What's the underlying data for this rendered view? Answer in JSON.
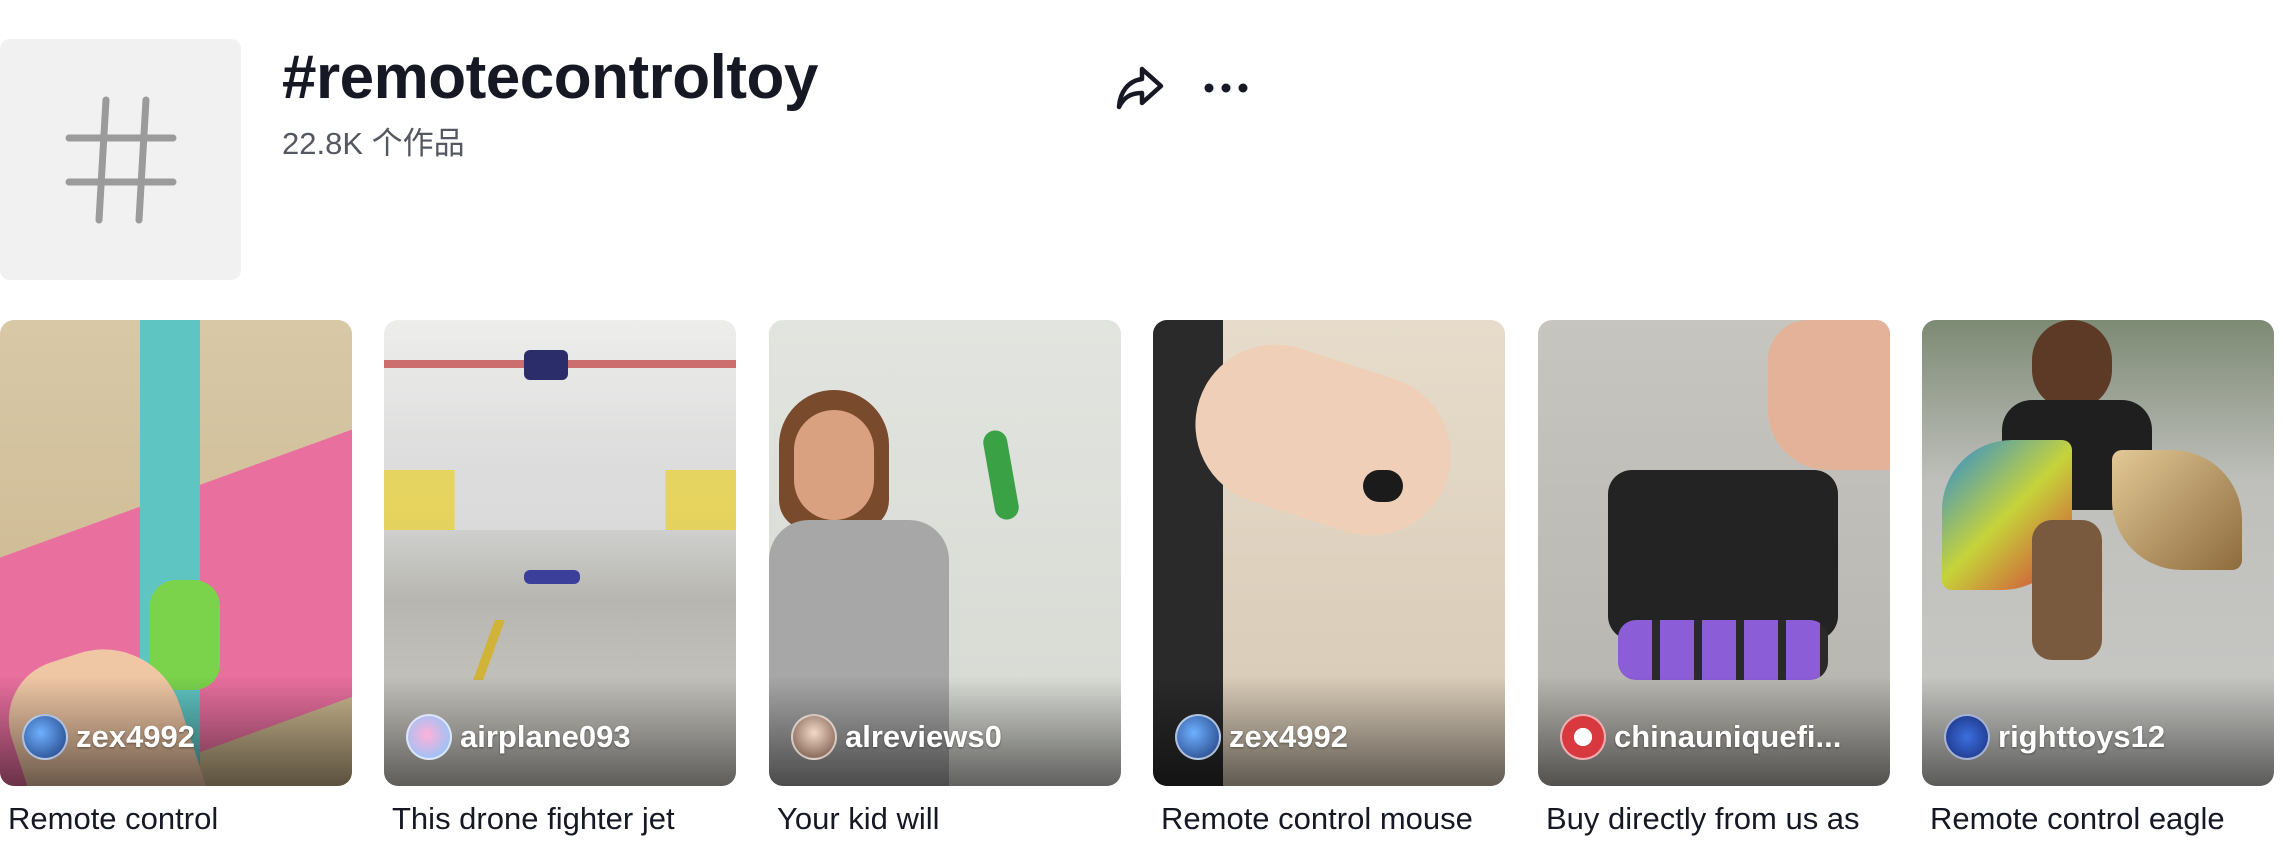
{
  "header": {
    "title": "#remotecontroltoy",
    "subtitle": "22.8K 个作品",
    "thumb_icon": "hashtag-icon",
    "share_icon": "share-arrow-icon",
    "more_icon": "more-dots-icon"
  },
  "videos": [
    {
      "author": "zex4992",
      "caption": "Remote control"
    },
    {
      "author": "airplane093",
      "caption": "This drone fighter jet"
    },
    {
      "author": "alreviews0",
      "caption": "Your kid will"
    },
    {
      "author": "zex4992",
      "caption": "Remote control mouse"
    },
    {
      "author": "chinauniquefi...",
      "caption": "Buy directly from us as"
    },
    {
      "author": "righttoys12",
      "caption": "Remote control eagle"
    }
  ],
  "colors": {
    "text_primary": "#161823",
    "text_secondary": "#555861",
    "thumb_bg": "#f1f1f2"
  }
}
